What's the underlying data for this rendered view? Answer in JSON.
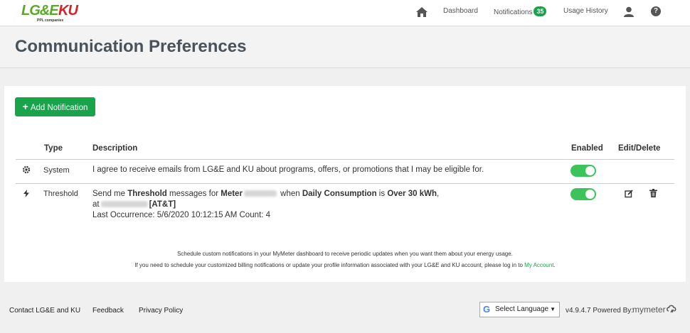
{
  "brand": {
    "lge": "LG&E",
    "ku": "KU",
    "sub": "PPL companies"
  },
  "nav": {
    "dashboard": "Dashboard",
    "notifications": "Notifications",
    "notifications_count": "35",
    "usage_history": "Usage History"
  },
  "page": {
    "title": "Communication Preferences"
  },
  "add_button": {
    "label": "Add Notification"
  },
  "table": {
    "headers": {
      "type": "Type",
      "description": "Description",
      "enabled": "Enabled",
      "edit_delete": "Edit/Delete"
    },
    "rows": [
      {
        "type": "System",
        "icon": "gear-icon",
        "description": "I agree to receive emails from LG&E and KU about programs, offers, or promotions that I may be eligible for.",
        "enabled": true
      },
      {
        "type": "Threshold",
        "icon": "bolt-icon",
        "desc_part1": "Send me ",
        "desc_bold1": "Threshold",
        "desc_part2": " messages for ",
        "desc_bold2": "Meter",
        "desc_part3": " when ",
        "desc_bold3": "Daily Consumption",
        "desc_part4": " is ",
        "desc_bold4": "Over 30 kWh",
        "desc_part5": ",",
        "desc_at": "at",
        "desc_carrier": "[AT&T]",
        "last_occurrence": "Last Occurrence: 5/6/2020 10:12:15 AM Count: 4",
        "enabled": true
      }
    ]
  },
  "notes": {
    "line1": "Schedule custom notifications in your MyMeter dashboard to receive periodic updates when you want them about your energy usage.",
    "line2": "If you need to schedule your customized billing notifications or update your profile information associated with your LG&E and KU account, please log in to ",
    "line2_link": "My Account",
    "line2_end": "."
  },
  "footer": {
    "contact": "Contact LG&E and KU",
    "feedback": "Feedback",
    "privacy": "Privacy Policy",
    "language": "Select Language",
    "version": "v4.9.4.7 Powered By:",
    "powered_brand": "mymeter"
  },
  "colors": {
    "accent": "#19a44c",
    "toggle_on": "#3cc35a",
    "title": "#4a525a",
    "ku_red": "#d2232a"
  }
}
